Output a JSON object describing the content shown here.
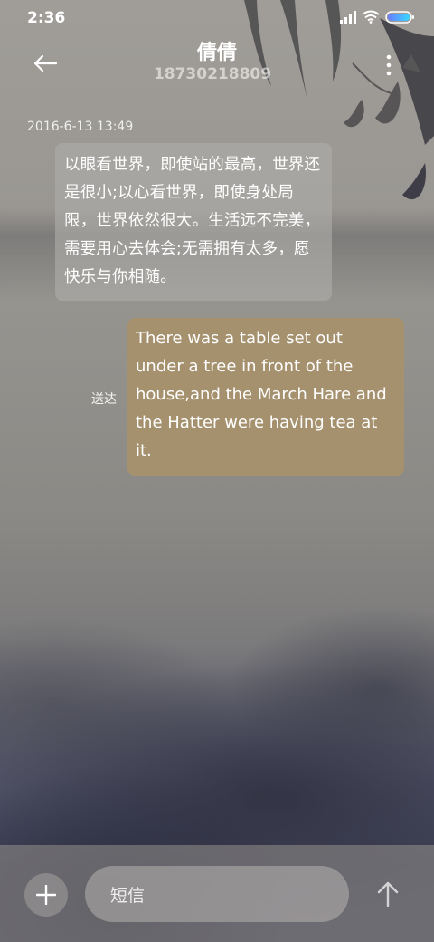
{
  "status_bar": {
    "time": "2:36",
    "icons": [
      "signal-icon",
      "wifi-icon",
      "battery-icon"
    ]
  },
  "header": {
    "back_icon": "back-arrow-icon",
    "contact_name": "倩倩",
    "contact_number": "18730218809",
    "more_icon": "more-vertical-icon"
  },
  "conversation": {
    "timestamp": "2016-6-13 13:49",
    "messages": [
      {
        "direction": "incoming",
        "text": "以眼看世界，即使站的最高，世界还是很小;以心看世界，即使身处局限，世界依然很大。生活远不完美，需要用心去体会;无需拥有太多，愿快乐与你相随。"
      },
      {
        "direction": "outgoing",
        "text": "There was a table set out under a tree in front of the house,and the March Hare and the Hatter were having tea at it.",
        "status": "送达"
      }
    ]
  },
  "composer": {
    "add_icon": "plus-icon",
    "placeholder": "短信",
    "send_icon": "arrow-up-icon"
  },
  "colors": {
    "outgoing_bubble": "#a5916e",
    "incoming_bubble": "#b0aeaa",
    "battery_gradient_start": "#6a7cff",
    "battery_gradient_end": "#38d8ff"
  }
}
